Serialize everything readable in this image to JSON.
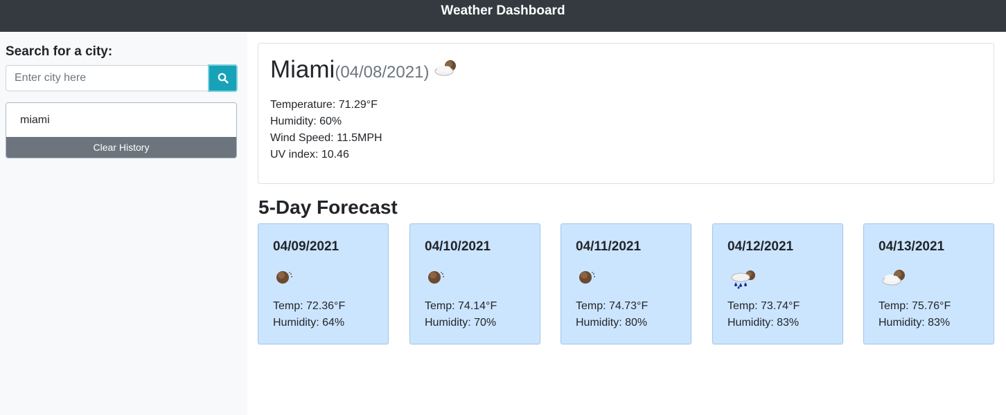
{
  "header": {
    "title": "Weather Dashboard"
  },
  "sidebar": {
    "search_label": "Search for a city:",
    "search_placeholder": "Enter city here",
    "history": [
      "miami"
    ],
    "clear_label": "Clear History"
  },
  "current": {
    "city": "Miami",
    "date": "(04/08/2021)",
    "icon": "partly-cloudy-icon",
    "temperature": "Temperature: 71.29°F",
    "humidity": "Humidity: 60%",
    "wind": "Wind Speed: 11.5MPH",
    "uv": "UV index: 10.46"
  },
  "forecast": {
    "title": "5-Day Forecast",
    "days": [
      {
        "date": "04/09/2021",
        "icon": "clear-night-icon",
        "temp": "Temp: 72.36°F",
        "humidity": "Humidity: 64%"
      },
      {
        "date": "04/10/2021",
        "icon": "clear-night-icon",
        "temp": "Temp: 74.14°F",
        "humidity": "Humidity: 70%"
      },
      {
        "date": "04/11/2021",
        "icon": "clear-night-icon",
        "temp": "Temp: 74.73°F",
        "humidity": "Humidity: 80%"
      },
      {
        "date": "04/12/2021",
        "icon": "rain-icon",
        "temp": "Temp: 73.74°F",
        "humidity": "Humidity: 83%"
      },
      {
        "date": "04/13/2021",
        "icon": "partly-cloudy-icon",
        "temp": "Temp: 75.76°F",
        "humidity": "Humidity: 83%"
      }
    ]
  },
  "colors": {
    "header_bg": "#343a40",
    "search_button": "#17a2b8",
    "clear_button": "#6c757d",
    "forecast_card": "#cce5ff"
  }
}
